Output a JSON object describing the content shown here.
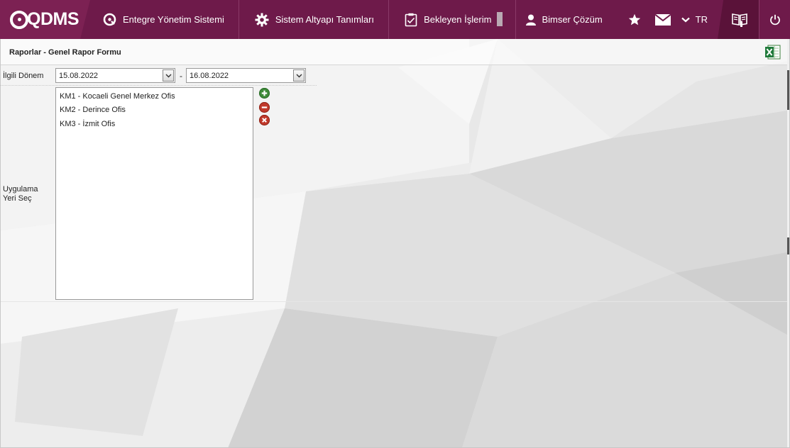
{
  "app": {
    "logo": "QDMS"
  },
  "nav": {
    "items": [
      {
        "label": "Entegre Yönetim Sistemi",
        "icon": "qdms-q-icon"
      },
      {
        "label": "Sistem Altyapı Tanımları",
        "icon": "gear-icon"
      },
      {
        "label": "Bekleyen İşlerim",
        "icon": "clipboard-check-icon"
      }
    ],
    "user": {
      "label": "Bimser Çözüm",
      "icon": "user-icon"
    },
    "language": "TR",
    "icons": {
      "favorites": "star-icon",
      "messages": "envelope-icon",
      "lang_toggle": "chevron-down-icon",
      "manual": "book-icon",
      "logout": "power-icon"
    }
  },
  "form": {
    "title": "Raporlar - Genel Rapor Formu",
    "export_icon": "excel-icon",
    "period": {
      "label": "İlgili Dönem",
      "start": "15.08.2022",
      "separator": "-",
      "end": "16.08.2022"
    },
    "location": {
      "label": "Uygulama Yeri Seç",
      "items": [
        "KM1 - Kocaeli Genel Merkez Ofis",
        "KM2 - Derince Ofis",
        "KM3 - İzmit Ofis"
      ],
      "actions": {
        "add": "plus-circle-icon",
        "remove": "minus-circle-icon",
        "clear": "x-circle-icon"
      }
    }
  },
  "colors": {
    "nav_bg": "#6e1a4a",
    "logo_bg": "#7c2153",
    "manual_bg": "#5a1239",
    "add_green": "#3f8a3a",
    "remove_red": "#c0392b"
  }
}
